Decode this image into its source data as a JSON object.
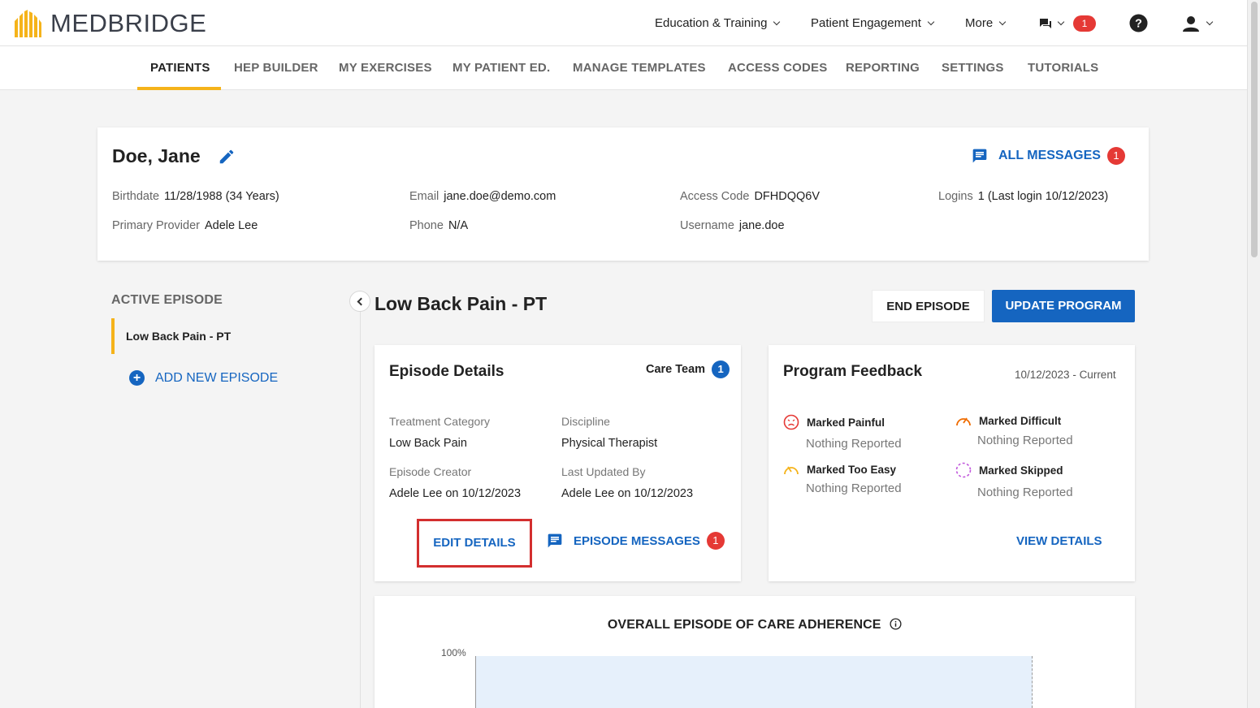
{
  "brand": {
    "name": "MEDBRIDGE",
    "accent": "#f5b31a",
    "primary": "#1565c0"
  },
  "topnav": {
    "education": "Education & Training",
    "engagement": "Patient Engagement",
    "more": "More",
    "messages_count": "1"
  },
  "tabs": [
    {
      "label": "PATIENTS"
    },
    {
      "label": "HEP BUILDER"
    },
    {
      "label": "MY EXERCISES"
    },
    {
      "label": "MY PATIENT ED."
    },
    {
      "label": "MANAGE TEMPLATES"
    },
    {
      "label": "ACCESS CODES"
    },
    {
      "label": "REPORTING"
    },
    {
      "label": "SETTINGS"
    },
    {
      "label": "TUTORIALS"
    }
  ],
  "patient": {
    "name": "Doe, Jane",
    "all_messages_label": "ALL MESSAGES",
    "all_messages_count": "1",
    "birthdate_label": "Birthdate",
    "birthdate": "11/28/1988 (34 Years)",
    "email_label": "Email",
    "email": "jane.doe@demo.com",
    "access_code_label": "Access Code",
    "access_code": "DFHDQQ6V",
    "logins_label": "Logins",
    "logins": "1 (Last login 10/12/2023)",
    "provider_label": "Primary Provider",
    "provider": "Adele Lee",
    "phone_label": "Phone",
    "phone": "N/A",
    "username_label": "Username",
    "username": "jane.doe"
  },
  "sidebar": {
    "active_episode_label": "ACTIVE EPISODE",
    "episode_name": "Low Back Pain - PT",
    "add_episode_label": "ADD NEW EPISODE"
  },
  "episode": {
    "title": "Low Back Pain - PT",
    "end_label": "END EPISODE",
    "update_label": "UPDATE PROGRAM",
    "details_title": "Episode Details",
    "care_team_label": "Care Team",
    "care_team_count": "1",
    "treatment_label": "Treatment Category",
    "treatment": "Low Back Pain",
    "discipline_label": "Discipline",
    "discipline": "Physical Therapist",
    "creator_label": "Episode Creator",
    "creator": "Adele Lee on 10/12/2023",
    "updated_label": "Last Updated By",
    "updated": "Adele Lee on 10/12/2023",
    "edit_label": "EDIT DETAILS",
    "messages_label": "EPISODE MESSAGES",
    "messages_count": "1"
  },
  "feedback": {
    "title": "Program Feedback",
    "range": "10/12/2023 - Current",
    "painful": "Marked Painful",
    "difficult": "Marked Difficult",
    "easy": "Marked Too Easy",
    "skipped": "Marked Skipped",
    "none": "Nothing Reported",
    "view_label": "VIEW DETAILS"
  },
  "adherence": {
    "title": "OVERALL EPISODE OF CARE ADHERENCE",
    "y_top": "100%"
  }
}
